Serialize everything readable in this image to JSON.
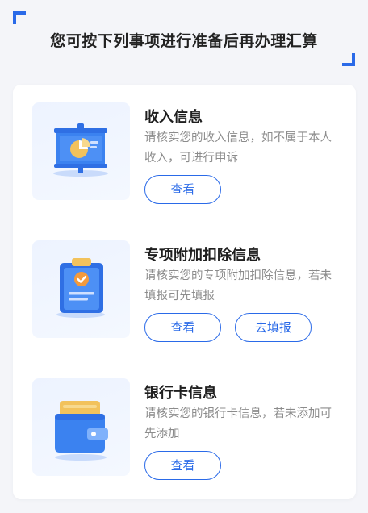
{
  "page": {
    "title": "您可按下列事项进行准备后再办理汇算"
  },
  "sections": [
    {
      "title": "收入信息",
      "desc": "请核实您的收入信息，如不属于本人收入，可进行申诉",
      "icon": "presentation-pie-chart-icon",
      "buttons": [
        "查看"
      ]
    },
    {
      "title": "专项附加扣除信息",
      "desc": "请核实您的专项附加扣除信息，若未填报可先填报",
      "icon": "clipboard-check-icon",
      "buttons": [
        "查看",
        "去填报"
      ]
    },
    {
      "title": "银行卡信息",
      "desc": "请核实您的银行卡信息，若未添加可先添加",
      "icon": "wallet-card-icon",
      "buttons": [
        "查看"
      ]
    }
  ],
  "colors": {
    "accent": "#2a6ae8",
    "background": "#f4f5f9",
    "muted_text": "#8c8c8c"
  }
}
